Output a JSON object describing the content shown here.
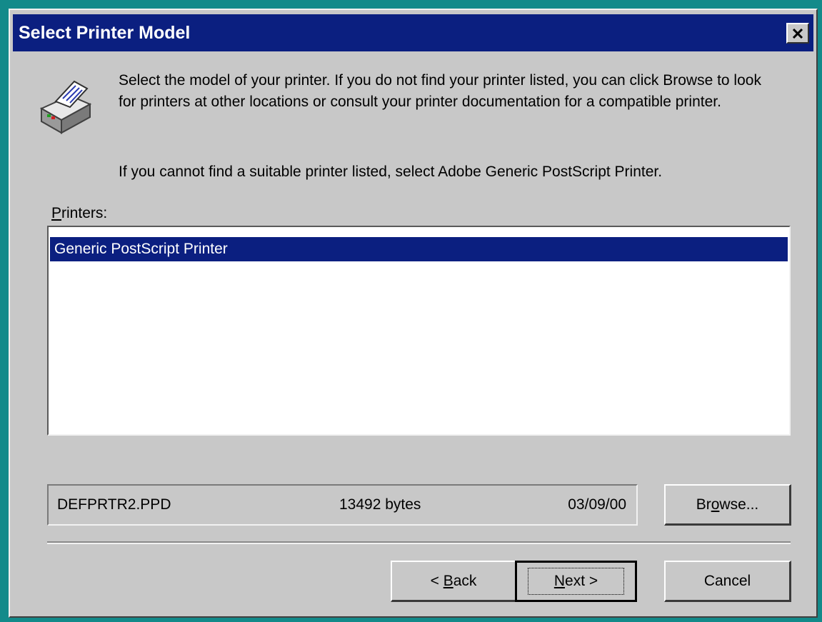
{
  "window": {
    "title": "Select Printer Model",
    "close_icon": "close-icon"
  },
  "content": {
    "icon": "printer-icon",
    "intro": "Select the model of your printer. If you do not find your printer listed, you can click Browse to look for printers at other locations or consult your printer documentation for a compatible printer.",
    "fallback": "If you cannot find a suitable printer listed, select Adobe Generic PostScript Printer."
  },
  "printers": {
    "label_first": "P",
    "label_rest": "rinters:",
    "items": [
      "Generic PostScript Printer"
    ],
    "selected_index": 0
  },
  "file_info": {
    "filename": "DEFPRTR2.PPD",
    "size": "13492 bytes",
    "date": "03/09/00"
  },
  "buttons": {
    "browse": {
      "pre": "Br",
      "accel": "o",
      "post": "wse..."
    },
    "back": {
      "pre": "< ",
      "accel": "B",
      "post": "ack"
    },
    "next": {
      "pre": "",
      "accel": "N",
      "post": "ext >"
    },
    "cancel": "Cancel"
  },
  "colors": {
    "desktop": "#138a8a",
    "titlebar": "#0b1f80",
    "selection": "#0b1f80",
    "face": "#c8c8c8"
  }
}
